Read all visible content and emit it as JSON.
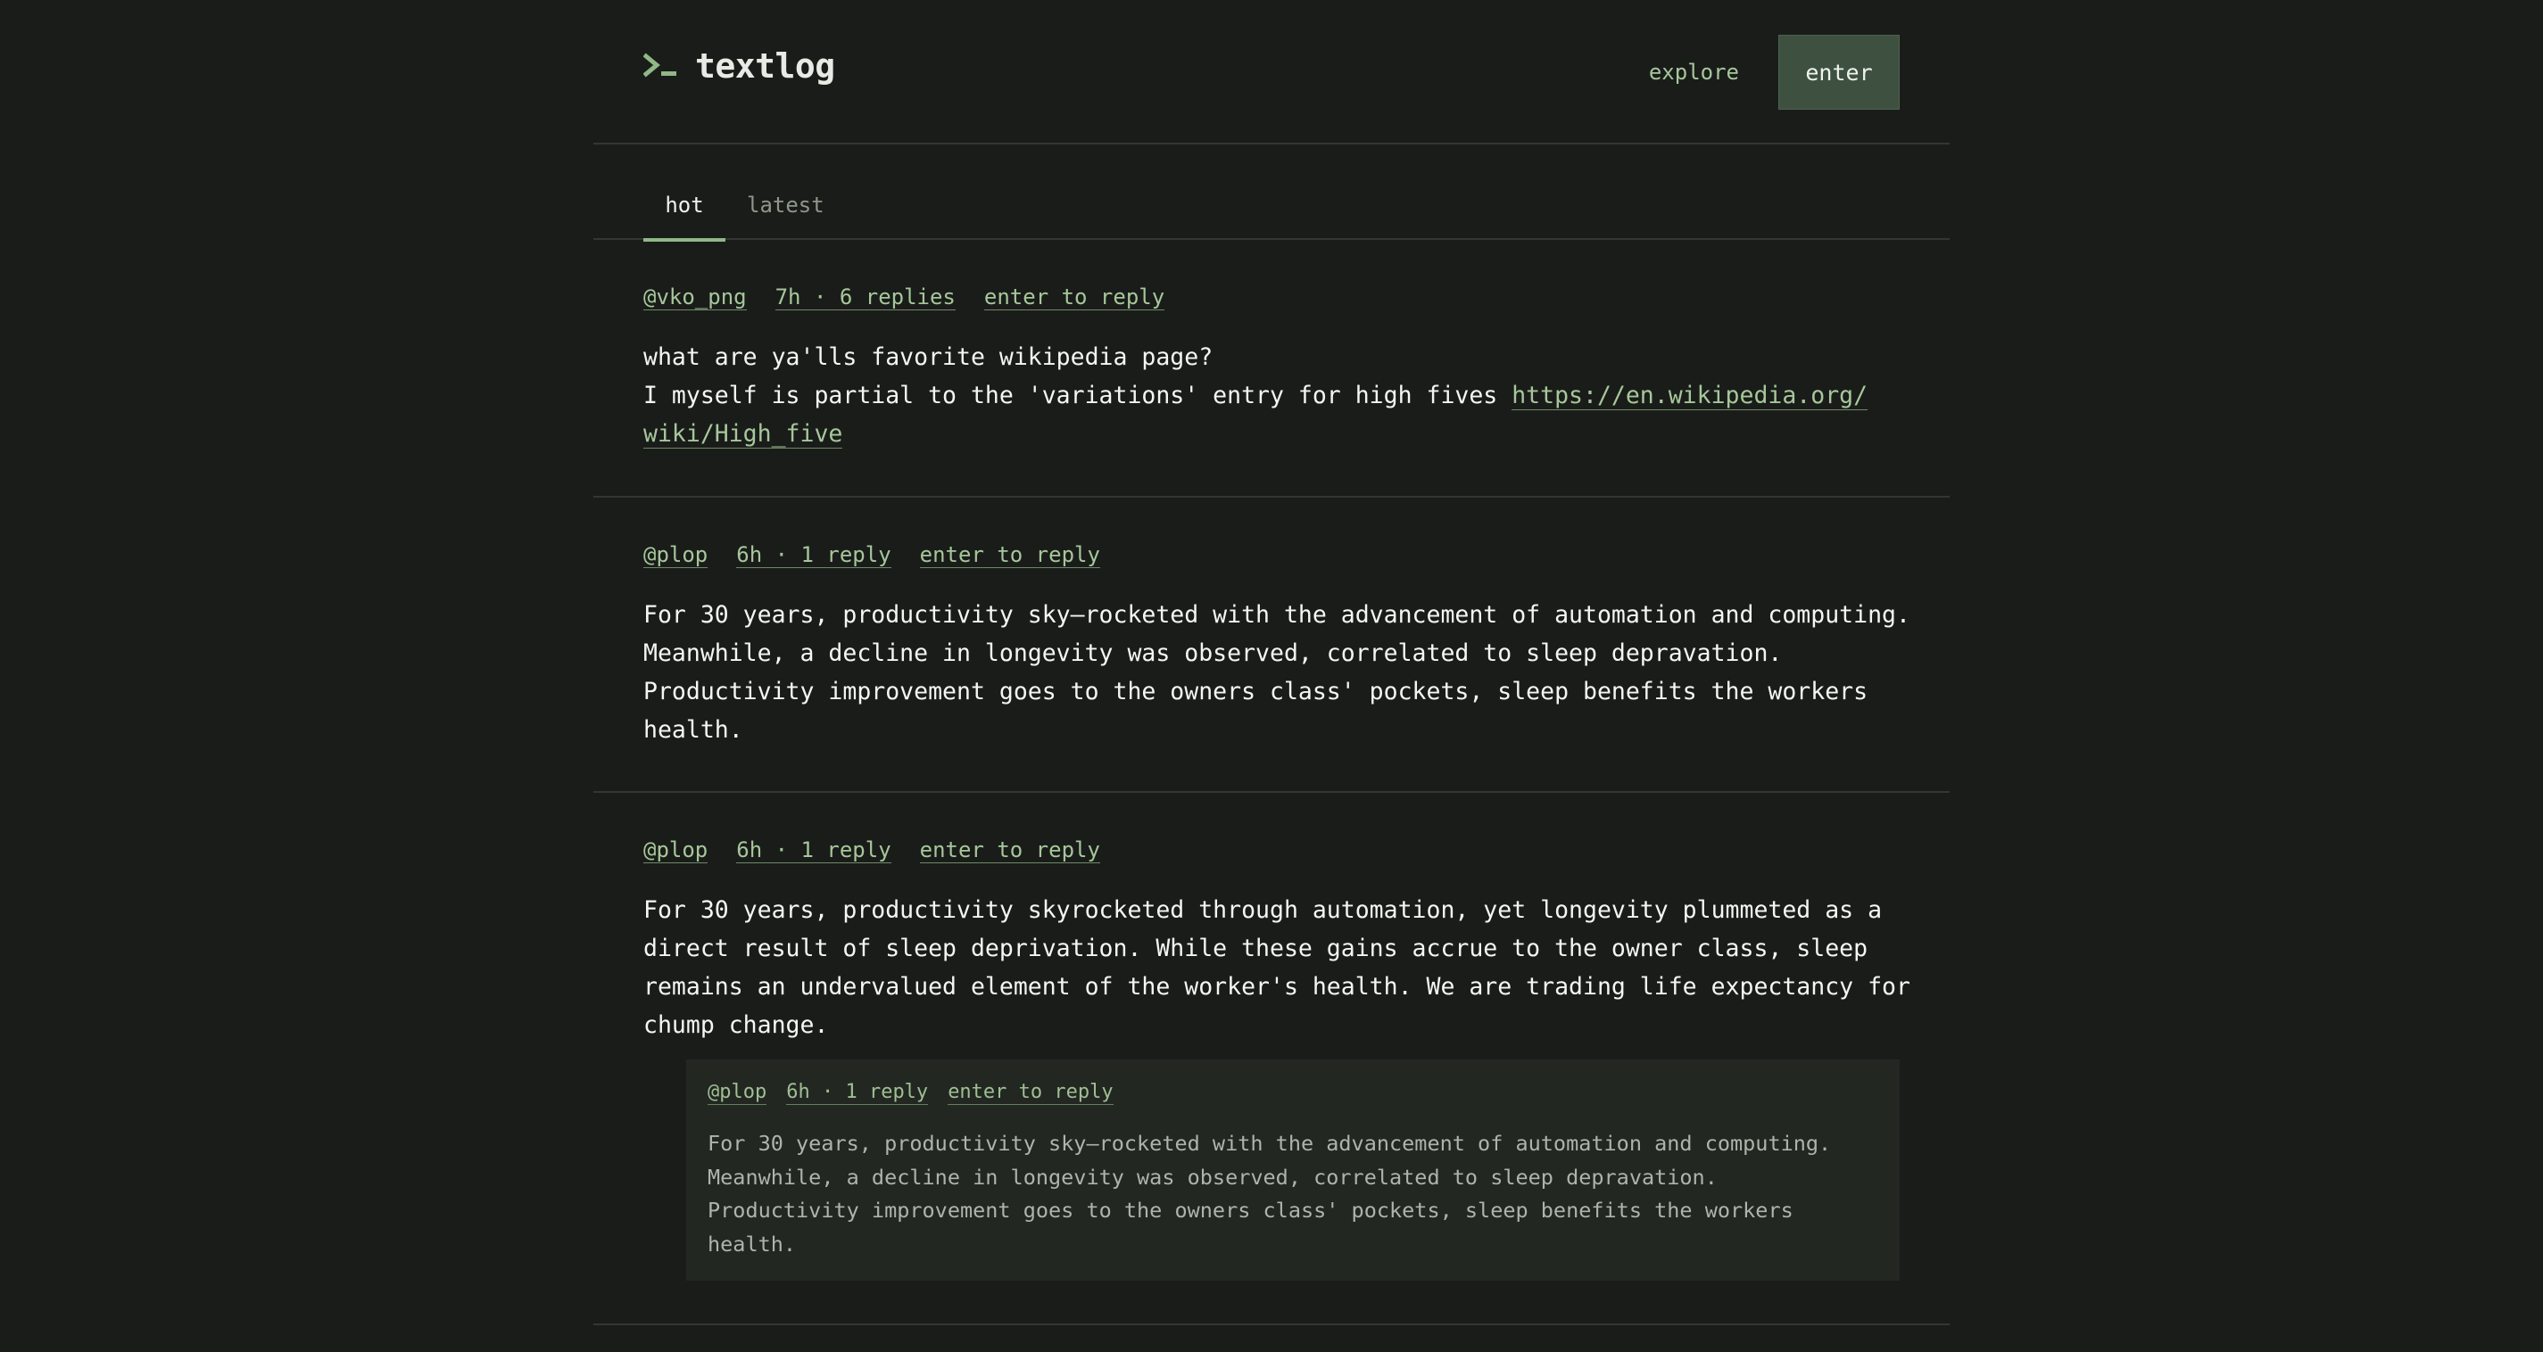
{
  "app": {
    "name": "textlog"
  },
  "nav": {
    "explore_label": "explore",
    "enter_label": "enter"
  },
  "tabs": [
    {
      "label": "hot",
      "active": true
    },
    {
      "label": "latest",
      "active": false
    }
  ],
  "posts": [
    {
      "author": "@vko_png",
      "time_replies": "7h · 6 replies",
      "reply_label": "enter to reply",
      "text": "what are ya'lls favorite wikipedia page?\nI myself is partial to the 'variations' entry for high fives ",
      "link_line1": "https://en.wikipedia.org/",
      "link_line2": "wiki/High_five"
    },
    {
      "author": "@plop",
      "time_replies": "6h · 1 reply",
      "reply_label": "enter to reply",
      "text": "For 30 years, productivity sky–rocketed with the advancement of automation and computing.\nMeanwhile, a decline in longevity was observed, correlated to sleep depravation.\nProductivity improvement goes to the owners class' pockets, sleep benefits the workers\nhealth."
    },
    {
      "author": "@plop",
      "time_replies": "6h · 1 reply",
      "reply_label": "enter to reply",
      "text": "For 30 years, productivity skyrocketed through automation, yet longevity plummeted as a\ndirect result of sleep deprivation. While these gains accrue to the owner class, sleep\nremains an undervalued element of the worker's health. We are trading life expectancy for\nchump change.",
      "quote": {
        "author": "@plop",
        "time_replies": "6h · 1 reply",
        "reply_label": "enter to reply",
        "text": "For 30 years, productivity sky–rocketed with the advancement of automation and computing.\nMeanwhile, a decline in longevity was observed, correlated to sleep depravation.\nProductivity improvement goes to the owners class' pockets, sleep benefits the workers\nhealth."
      }
    }
  ],
  "colors": {
    "background": "#1a1c1a",
    "accent": "#a6c79a",
    "button": "#3e5140",
    "quote_bg": "#232722"
  }
}
